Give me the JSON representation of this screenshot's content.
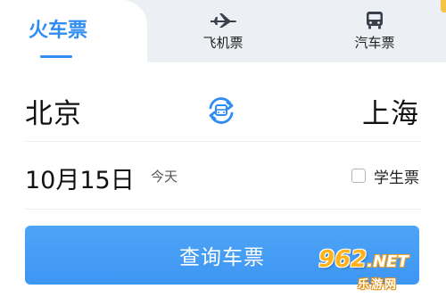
{
  "tabs": {
    "train_label": "火车票",
    "flight_label": "飞机票",
    "bus_label": "汽车票",
    "active": "train"
  },
  "route": {
    "from_city": "北京",
    "to_city": "上海",
    "swap_icon": "swap-arrows-icon"
  },
  "date": {
    "value": "10月15日",
    "tag": "今天"
  },
  "student": {
    "label": "学生票",
    "checked": false
  },
  "search": {
    "label": "查询车票"
  },
  "watermark": {
    "main": "962",
    "suffix": ".NET",
    "sub": "乐游网"
  },
  "colors": {
    "accent": "#2f8cf0",
    "button": "#3d96f3",
    "tab_inactive_bg": "#eceff3",
    "watermark": "#ffb21a"
  }
}
